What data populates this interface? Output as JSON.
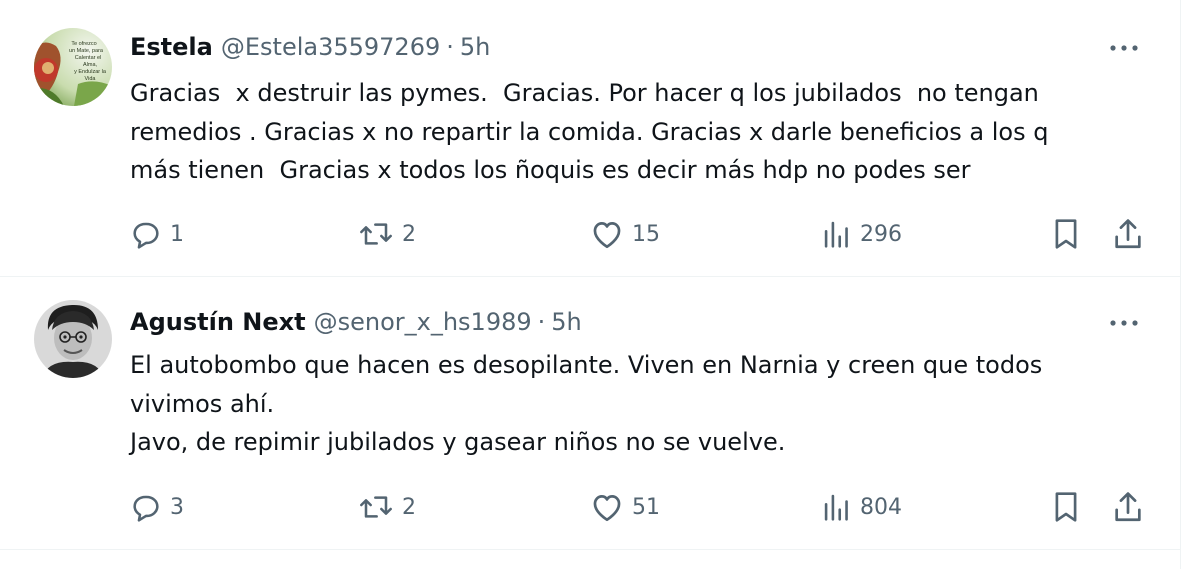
{
  "tweets": [
    {
      "name": "Estela",
      "handle": "@Estela35597269",
      "separator": "·",
      "time": "5h",
      "text": "Gracias  x destruir las pymes.  Gracias. Por hacer q los jubilados  no tengan\nremedios . Gracias x no repartir la comida. Gracias x darle beneficios a los q\nmás tienen  Gracias x todos los ñoquis es decir más hdp no podes ser",
      "replies": "1",
      "reposts": "2",
      "likes": "15",
      "views": "296",
      "avatar_text": "Te ofrezco un Mate, para Calentar el Alma, y Endulzar la Vida",
      "colors": {
        "accent": "#536471"
      }
    },
    {
      "name": "Agustín Next",
      "handle": "@senor_x_hs1989",
      "separator": "·",
      "time": "5h",
      "text": "El autobombo que hacen es desopilante. Viven en Narnia y creen que todos\nvivimos ahí.\nJavo, de repimir jubilados y gasear niños no se vuelve.",
      "replies": "3",
      "reposts": "2",
      "likes": "51",
      "views": "804"
    }
  ],
  "icons": {
    "reply": "reply-icon",
    "repost": "repost-icon",
    "like": "heart-icon",
    "views": "views-icon",
    "bookmark": "bookmark-icon",
    "share": "share-icon",
    "more": "more-icon"
  }
}
